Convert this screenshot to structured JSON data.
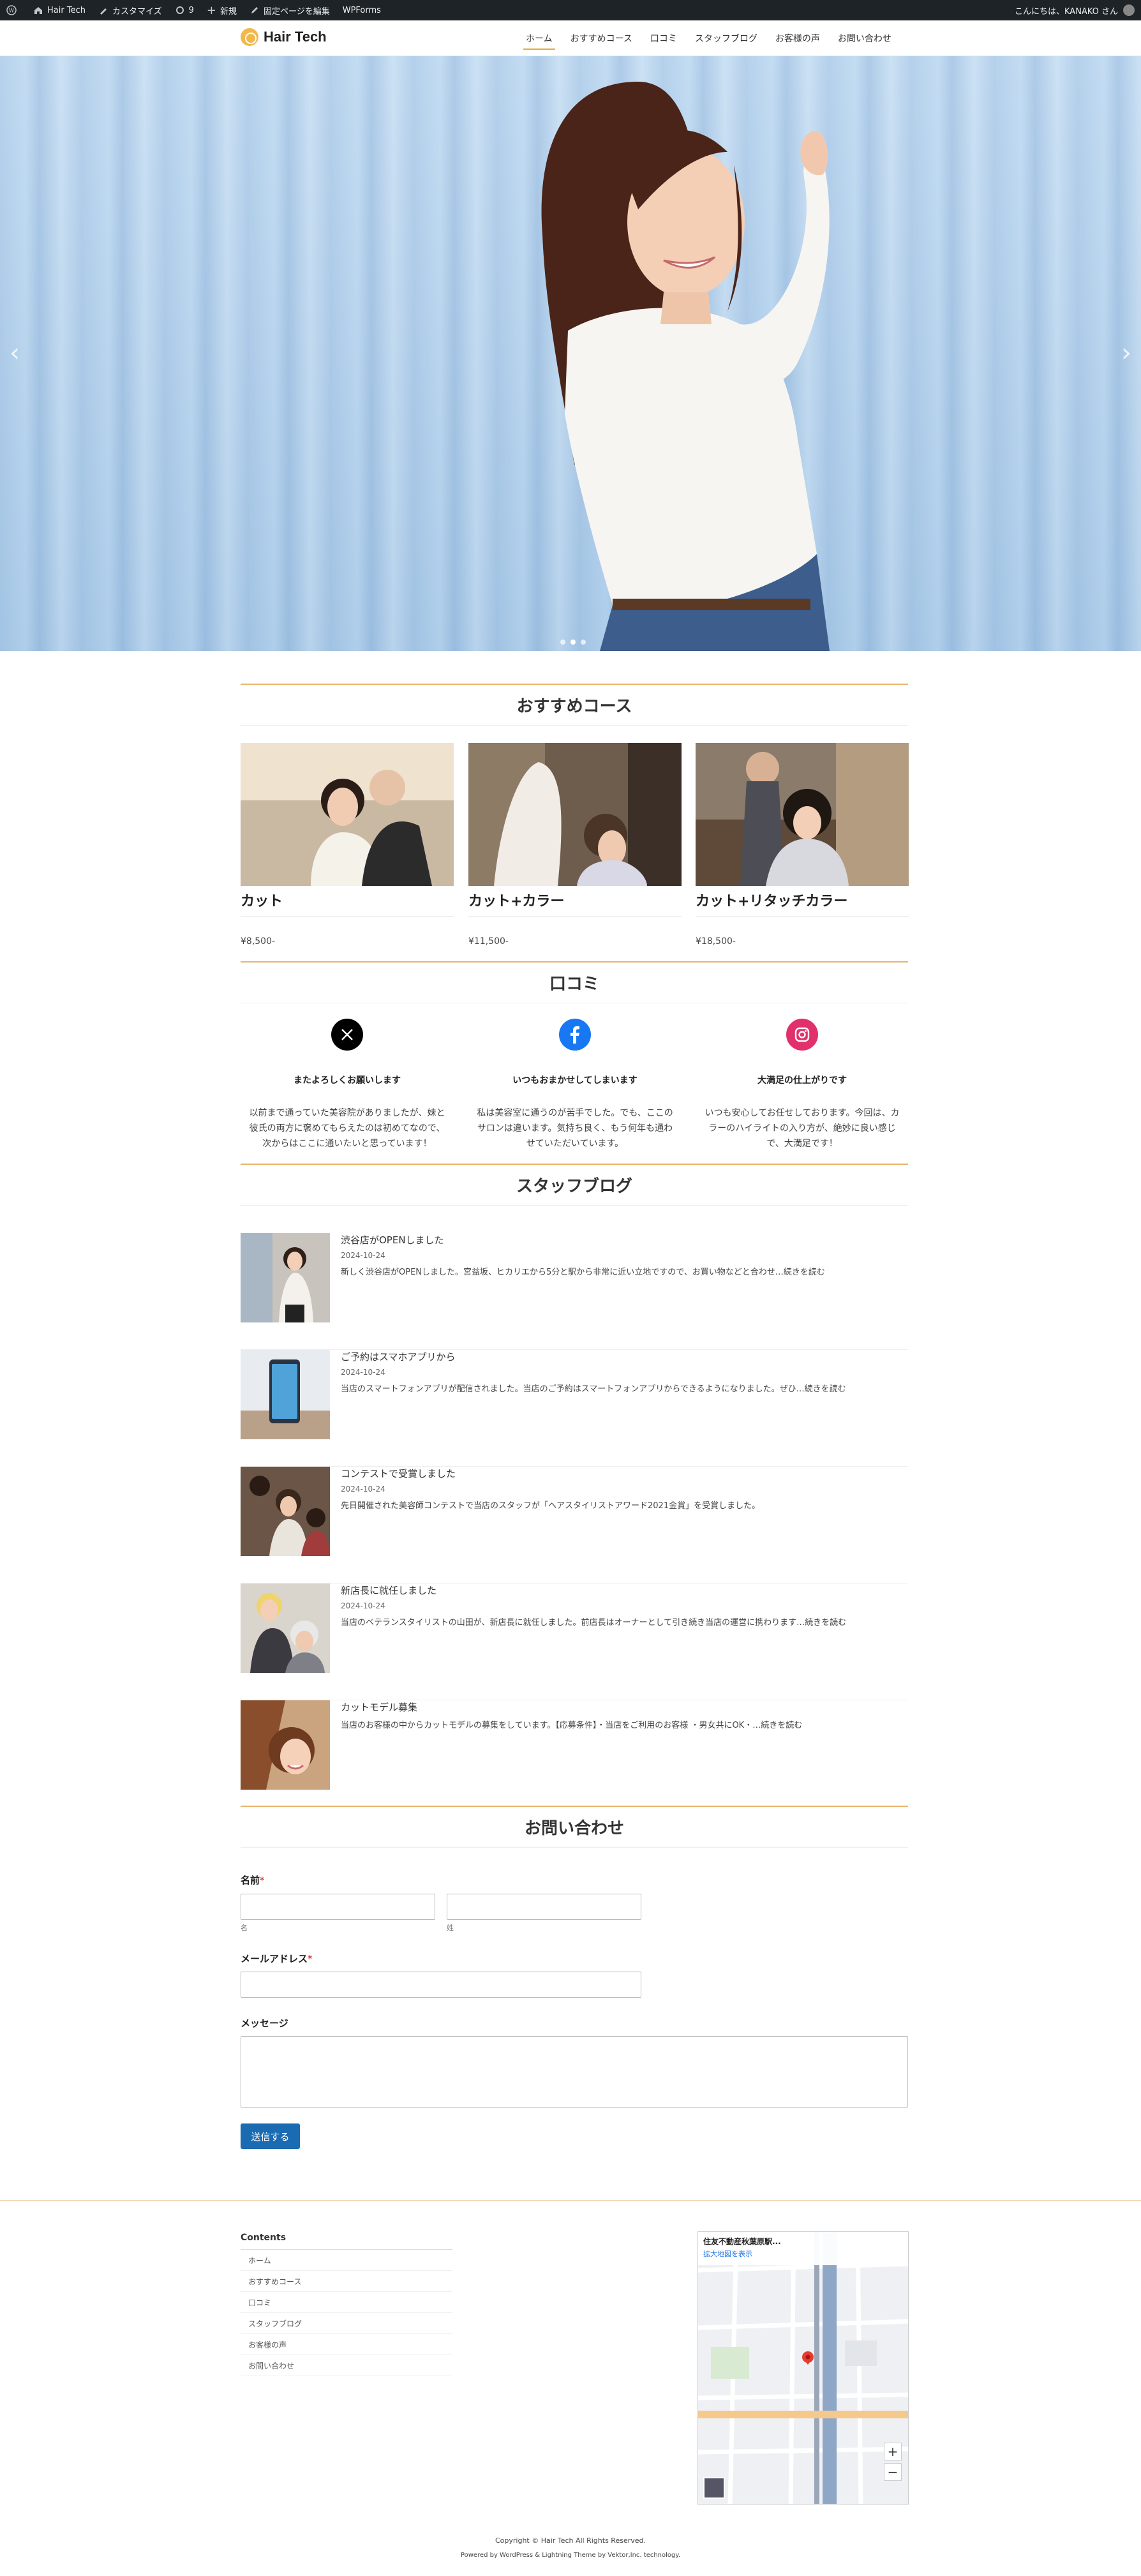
{
  "adminbar": {
    "site_name": "Hair Tech",
    "customize": "カスタマイズ",
    "updates_count": "9",
    "new_label": "新規",
    "edit_page": "固定ページを編集",
    "wpforms": "WPForms",
    "greeting": "こんにちは、KANAKO さん"
  },
  "header": {
    "logo_text": "Hair Tech",
    "nav": [
      "ホーム",
      "おすすめコース",
      "口コミ",
      "スタッフブログ",
      "お客様の声",
      "お問い合わせ"
    ],
    "active_index": 0
  },
  "hero": {
    "prev_icon": "chevron-left-icon",
    "next_icon": "chevron-right-icon",
    "slides": 3,
    "active_slide": 2
  },
  "courses": {
    "title": "おすすめコース",
    "items": [
      {
        "name": "カット",
        "price": "¥8,500-"
      },
      {
        "name": "カット+カラー",
        "price": "¥11,500-"
      },
      {
        "name": "カット+リタッチカラー",
        "price": "¥18,500-"
      }
    ]
  },
  "reviews": {
    "title": "口コミ",
    "items": [
      {
        "icon": "x-icon",
        "color": "#000000",
        "heading": "またよろしくお願いします",
        "text_lines": [
          "以前まで通っていた美容院がありましたが、妹と",
          "彼氏の両方に褒めてもらえたのは初めてなので、",
          "次からはここに通いたいと思っています！"
        ]
      },
      {
        "icon": "facebook-icon",
        "color": "#1877f2",
        "heading": "いつもおまかせしてしまいます",
        "text_lines": [
          "私は美容室に通うのが苦手でした。でも、ここの",
          "サロンは違います。気持ち良く、もう何年も通わ",
          "せていただいています。"
        ]
      },
      {
        "icon": "instagram-icon",
        "color": "#e1306c",
        "heading": "大満足の仕上がりです",
        "text_lines": [
          "いつも安心してお任せしております。今回は、カ",
          "ラーのハイライトの入り方が、絶妙に良い感じ",
          "で、大満足です！"
        ]
      }
    ]
  },
  "blog": {
    "title": "スタッフブログ",
    "posts": [
      {
        "title": "渋谷店がOPENしました",
        "date": "2024-10-24",
        "excerpt": "新しく渋谷店がOPENしました。宮益坂、ヒカリエから5分と駅から非常に近い立地ですので、お買い物などと合わせ…続きを読む"
      },
      {
        "title": "ご予約はスマホアプリから",
        "date": "2024-10-24",
        "excerpt": "当店のスマートフォンアプリが配信されました。当店のご予約はスマートフォンアプリからできるようになりました。ぜひ…続きを読む"
      },
      {
        "title": "コンテストで受賞しました",
        "date": "2024-10-24",
        "excerpt": "先日開催された美容師コンテストで当店のスタッフが「ヘアスタイリストアワード2021金賞」を受賞しました。"
      },
      {
        "title": "新店長に就任しました",
        "date": "2024-10-24",
        "excerpt": "当店のベテランスタイリストの山田が、新店長に就任しました。前店長はオーナーとして引き続き当店の運営に携わります…続きを読む"
      },
      {
        "title": "カットモデル募集",
        "date": "",
        "excerpt": "当店のお客様の中からカットモデルの募集をしています。【応募条件】・当店をご利用のお客様 ・男女共にOK・…続きを読む"
      }
    ]
  },
  "contact": {
    "title": "お問い合わせ",
    "name_label": "名前",
    "required_mark": "*",
    "first_sub": "名",
    "last_sub": "姓",
    "email_label": "メールアドレス",
    "message_label": "メッセージ",
    "submit_label": "送信する",
    "first_value": "",
    "last_value": "",
    "email_value": "",
    "message_value": ""
  },
  "footer": {
    "contents_title": "Contents",
    "menu": [
      "ホーム",
      "おすすめコース",
      "口コミ",
      "スタッフブログ",
      "お客様の声",
      "お問い合わせ"
    ],
    "map_title": "住友不動産秋葉原駅...",
    "map_link": "拡大地図を表示",
    "map_zoom_in": "+",
    "map_zoom_out": "−",
    "copyright": "Copyright © Hair Tech All Rights Reserved.",
    "powered": "Powered by WordPress & Lightning Theme by Vektor,Inc. technology."
  },
  "colors": {
    "accent": "#e9b46a",
    "button": "#1b6bb3",
    "adminbar": "#1d2327"
  }
}
